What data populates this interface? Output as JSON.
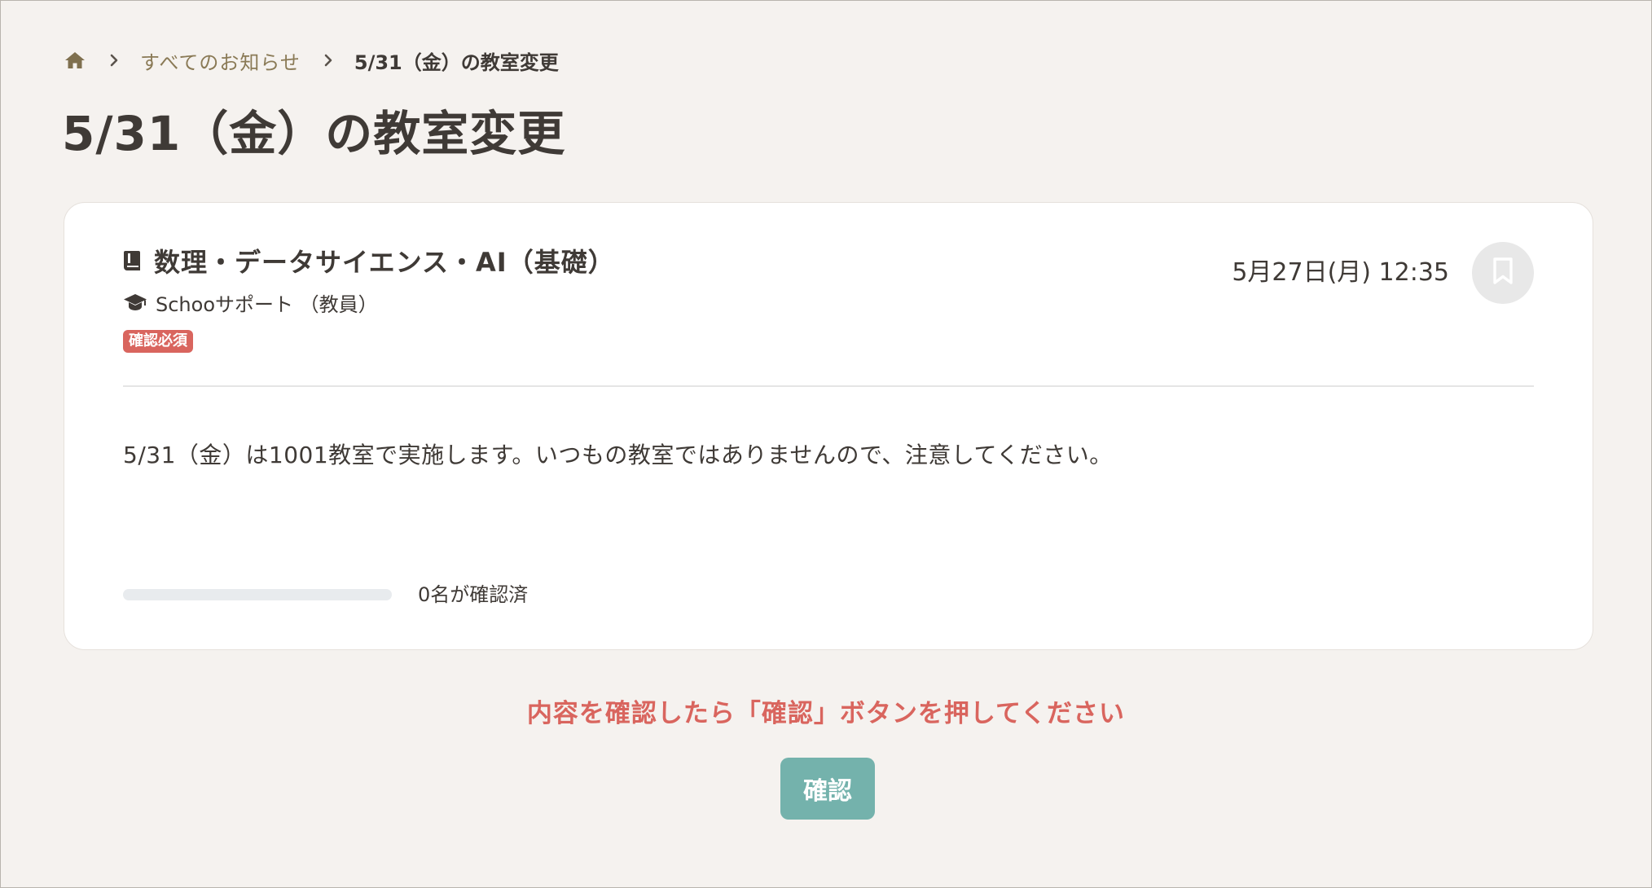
{
  "breadcrumb": {
    "all_notices": "すべてのお知らせ",
    "current": "5/31（金）の教室変更"
  },
  "page": {
    "title": "5/31（金）の教室変更"
  },
  "notice": {
    "course_name": "数理・データサイエンス・AI（基礎）",
    "author": "Schooサポート （教員）",
    "badge": "確認必須",
    "posted_at": "5月27日(月) 12:35",
    "body": "5/31（金）は1001教室で実施します。いつもの教室ではありませんので、注意してください。",
    "confirmed_count_text": "0名が確認済",
    "confirmed_fraction": 0
  },
  "footer": {
    "instruction": "内容を確認したら「確認」ボタンを押してください",
    "confirm_label": "確認"
  },
  "colors": {
    "background": "#f5f2ef",
    "accent_red": "#d9655e",
    "accent_teal": "#74b2ac",
    "breadcrumb_link": "#8a7a56"
  },
  "icons": {
    "home": "home-icon",
    "separator": "chevron-right-icon",
    "course": "book-icon",
    "author": "graduation-cap-icon",
    "bookmark": "bookmark-icon"
  }
}
